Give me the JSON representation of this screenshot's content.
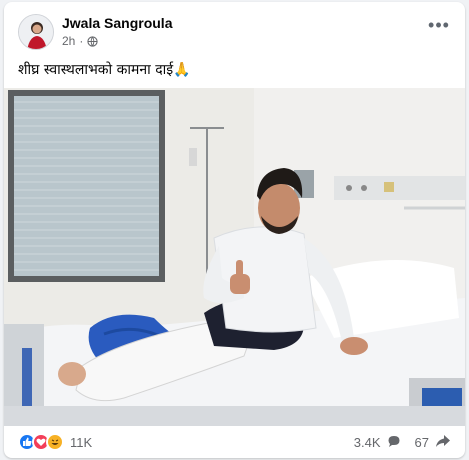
{
  "post": {
    "author": "Jwala Sangroula",
    "time": "2h",
    "privacy_icon": "globe-icon",
    "more_icon": "more-dots-icon",
    "caption": "शीघ्र स्वास्थलाभको कामना दाई",
    "caption_emoji": "🙏"
  },
  "stats": {
    "reaction_icons": [
      "like-icon",
      "love-icon",
      "haha-icon"
    ],
    "reaction_count": "11K",
    "comment_count": "3.4K",
    "share_count": "67"
  },
  "colors": {
    "like": "#1877f2",
    "love": "#f33e58",
    "haha": "#f7b125",
    "secondary_text": "#65676b"
  }
}
